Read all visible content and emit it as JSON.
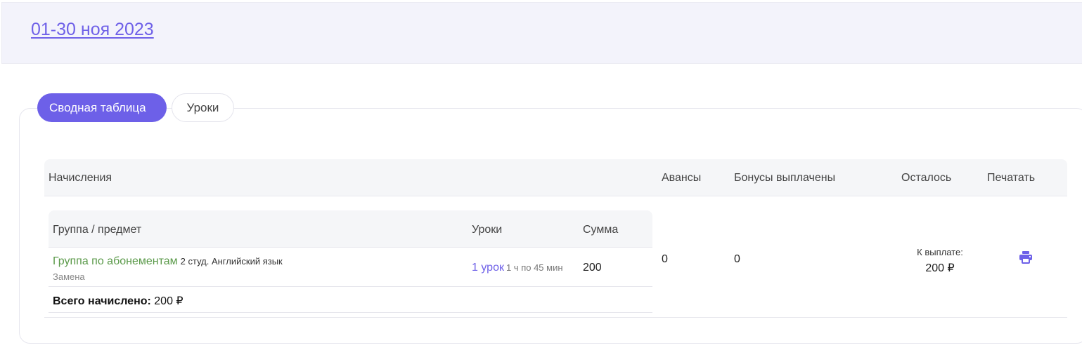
{
  "header": {
    "period": "01-30 ноя 2023"
  },
  "tabs": [
    {
      "label": "Сводная таблица",
      "active": true
    },
    {
      "label": "Уроки",
      "active": false
    }
  ],
  "main_table": {
    "columns": {
      "accruals": "Начисления",
      "advances": "Авансы",
      "bonuses": "Бонусы выплачены",
      "remaining": "Осталось",
      "print": "Печатать"
    },
    "advances_value": "0",
    "bonuses_value": "0",
    "remaining_label": "К выплате:",
    "remaining_value": "200 ₽"
  },
  "inner_table": {
    "columns": {
      "group": "Группа / предмет",
      "lessons": "Уроки",
      "sum": "Сумма"
    },
    "rows": [
      {
        "group_name": "Группа по абонементам",
        "group_meta": "2 студ. Английский язык",
        "group_sub": "Замена",
        "lessons": "1 урок",
        "lessons_meta": "1 ч по 45 мин",
        "sum": "200"
      }
    ],
    "total_label": "Всего начислено:",
    "total_value": "200 ₽"
  },
  "colors": {
    "accent": "#6d60e8",
    "group_link": "#5b9a4a",
    "header_bg": "#f3f3fb"
  },
  "icons": {
    "print": "printer-icon"
  }
}
